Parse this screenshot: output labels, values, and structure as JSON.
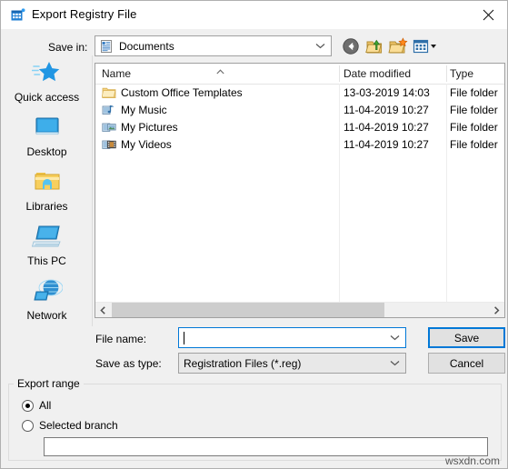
{
  "window": {
    "title": "Export Registry File",
    "icon": "registry-editor-icon",
    "close_label": "✕"
  },
  "savein": {
    "label": "Save in:",
    "value": "Documents",
    "icon": "documents-folder-icon"
  },
  "toolbar": {
    "buttons": [
      {
        "name": "back-button",
        "icon": "back-arrow-icon",
        "tooltip": "Back"
      },
      {
        "name": "up-one-level-button",
        "icon": "up-folder-icon",
        "tooltip": "Up one level"
      },
      {
        "name": "new-folder-button",
        "icon": "new-folder-icon",
        "tooltip": "Create New Folder"
      },
      {
        "name": "views-button",
        "icon": "views-icon",
        "tooltip": "Views"
      }
    ]
  },
  "places": [
    {
      "label": "Quick access",
      "icon": "star-icon"
    },
    {
      "label": "Desktop",
      "icon": "desktop-icon"
    },
    {
      "label": "Libraries",
      "icon": "libraries-folder-icon"
    },
    {
      "label": "This PC",
      "icon": "computer-icon"
    },
    {
      "label": "Network",
      "icon": "network-globe-icon"
    }
  ],
  "filelist": {
    "columns": [
      "Name",
      "Date modified",
      "Type"
    ],
    "sort_column": "Name",
    "sort_direction": "ascending",
    "rows": [
      {
        "name": "Custom Office Templates",
        "date": "13-03-2019 14:03",
        "type": "File folder",
        "icon": "folder-icon"
      },
      {
        "name": "My Music",
        "date": "11-04-2019 10:27",
        "type": "File folder",
        "icon": "music-folder-icon"
      },
      {
        "name": "My Pictures",
        "date": "11-04-2019 10:27",
        "type": "File folder",
        "icon": "pictures-folder-icon"
      },
      {
        "name": "My Videos",
        "date": "11-04-2019 10:27",
        "type": "File folder",
        "icon": "videos-folder-icon"
      }
    ]
  },
  "form": {
    "filename_label": "File name:",
    "filename_value": "",
    "savetype_label": "Save as type:",
    "savetype_value": "Registration Files (*.reg)",
    "save_label": "Save",
    "cancel_label": "Cancel"
  },
  "export_range": {
    "title": "Export range",
    "options": [
      {
        "label": "All",
        "selected": true
      },
      {
        "label": "Selected branch",
        "selected": false
      }
    ],
    "branch_value": ""
  },
  "watermark": "wsxdn.com",
  "colors": {
    "accent": "#0078d7",
    "dialog_bg": "#f0f0f0",
    "field_bg": "#ffffff",
    "disabled_field_bg": "#e8e8e8",
    "button_bg": "#e1e1e1",
    "scroll_thumb": "#cdcdcd"
  }
}
